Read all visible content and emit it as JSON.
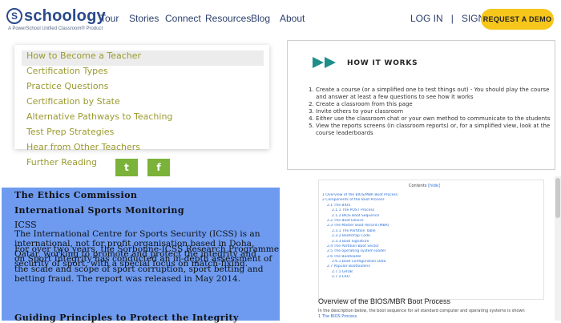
{
  "header": {
    "logo_mark": "S",
    "logo_text": "schoology",
    "logo_tagline": "A PowerSchool Unified Classroom® Product",
    "nav": [
      "Tour",
      "Stories",
      "Connect",
      "Resources",
      "Blog",
      "About"
    ],
    "login": "LOG IN",
    "divider": "|",
    "signup": "SIGN UP",
    "demo_button": "REQUEST A DEMO"
  },
  "menu": {
    "items": [
      "How to Become a Teacher",
      "Certification Types",
      "Practice Questions",
      "Certification by State",
      "Alternative Pathways to Teaching",
      "Test Prep Strategies",
      "Hear from Other Teachers",
      "Further Reading"
    ],
    "active_index": 0
  },
  "social": {
    "twitter": "t",
    "facebook": "f",
    "color": "#7bb23a"
  },
  "how_it_works": {
    "title": "HOW IT WORKS",
    "steps": [
      "Create a course (or a simplified one to test things out) - You should play the course and answer at least a few questions to see how it works",
      "Create a classroom from this page",
      "Invite others to your classroom",
      "Either use the classroom chat or your own method to communicate to the students",
      "View the reports screens (in classroom reports) or, for a simplified view, look at the course leaderboards"
    ]
  },
  "article": {
    "heading1": "The Ethics Commission",
    "heading2": "International Sports Monitoring",
    "heading3": "ICSS",
    "para1": "The International Centre for Sports Security (ICSS) is an international, not for profit organisation based in Doha, Qatar, working to promote and protect the integrity and security of sport, with a special focus on match-fixing.",
    "para2": "For over two years, the Sorbonne-ICSS Research Programme on Sport Integrity has conducted an in-depth assessment of the scale and scope of sport corruption, sport betting and betting fraud. The report was released in May 2014.",
    "heading4": "Guiding Principles to Protect the Integrity",
    "highlight_color": "#6e9bf0"
  },
  "doc": {
    "contents_label": "Contents",
    "hide_label": "[hide]",
    "toc": [
      "1 Overview of the BIOS/MBR Boot Process",
      "2 Components of the Boot Process",
      "2.1 The BIOS",
      "2.1.1 The POST Process",
      "2.1.2 BIOS Boot Sequence",
      "2.2 The Boot Device",
      "2.3 The Master Boot Record (MBR)",
      "2.3.1 The Partition Table",
      "2.3.2 Bootstrap Code",
      "2.3.3 Boot Signature",
      "2.4 The Partition Boot Sector",
      "2.5 The operating system loader",
      "2.6 The Bootloader",
      "2.6.1 Boot Configuration Data",
      "2.7 Popular Bootloaders",
      "2.7.1 GRUB",
      "2.7.2 LILO"
    ],
    "heading": "Overview of the BIOS/MBR Boot Process",
    "subtext": "In the description below, the boot sequence for all standard computer and operating systems is shown",
    "subtext2": "1 The BIOS Process"
  }
}
